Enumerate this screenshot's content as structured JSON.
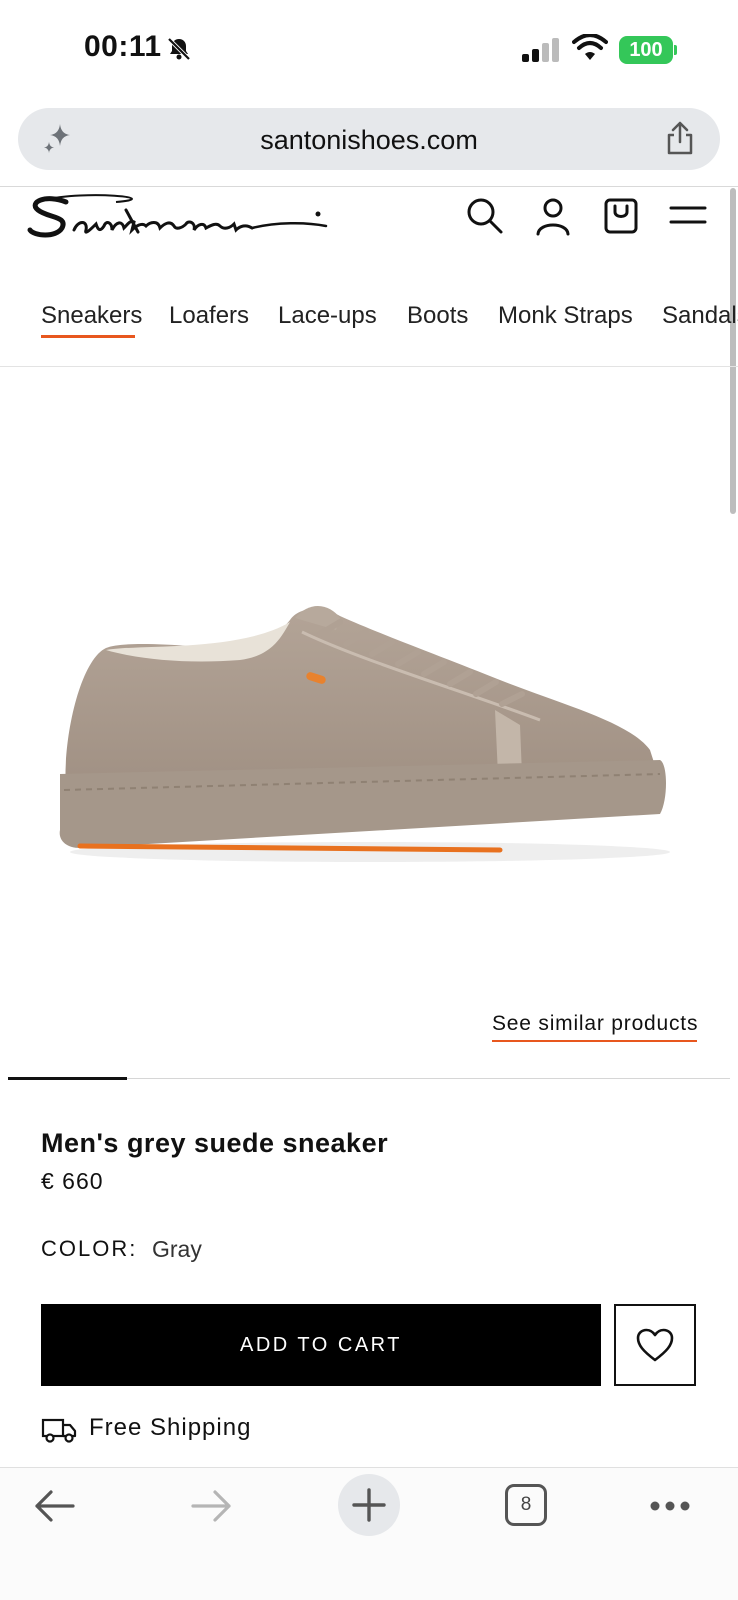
{
  "status_bar": {
    "time": "00:11",
    "battery": "100"
  },
  "browser": {
    "url": "santonishoes.com",
    "tab_count": "8"
  },
  "site": {
    "logo_text": "Santoni",
    "categories": [
      "Sneakers",
      "Loafers",
      "Lace-ups",
      "Boots",
      "Monk Straps",
      "Sandals"
    ],
    "active_category": "Sneakers"
  },
  "product": {
    "see_similar": "See similar products",
    "title": "Men's grey suede sneaker",
    "price": "€ 660",
    "color_label": "COLOR:",
    "color_value": "Gray",
    "add_to_cart": "ADD TO CART",
    "shipping": "Free Shipping"
  },
  "colors": {
    "accent": "#e8571e",
    "suede": "#a8988b",
    "battery": "#34c759"
  }
}
